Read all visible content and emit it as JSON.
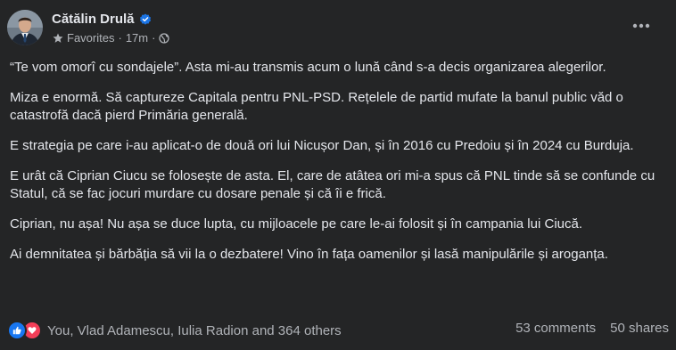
{
  "post": {
    "author": "Cătălin Drulă",
    "audience": "Favorites",
    "time": "17m",
    "paragraphs": [
      "“Te vom omorî cu sondajele”. Asta mi-au transmis acum o lună când s-a decis organizarea alegerilor.",
      "Miza e enormă. Să captureze Capitala pentru PNL-PSD. Rețelele de partid mufate la banul public văd o catastrofă dacă pierd Primăria generală.",
      "E strategia pe care i-au aplicat-o de două ori lui Nicușor Dan, și în 2016 cu Predoiu și în 2024 cu Burduja.",
      "E urât că Ciprian Ciucu se folosește de asta. El, care de atâtea ori mi-a spus că PNL tinde să se confunde cu Statul, că se fac jocuri murdare cu dosare penale și că îi e frică.",
      "Ciprian, nu așa! Nu așa se duce lupta, cu mijloacele pe care le-ai folosit și în campania lui Ciucă.",
      "Ai demnitatea și bărbăția să vii la o dezbatere! Vino în fața oamenilor și lasă manipulările și aroganța."
    ],
    "reactions_text": "You, Vlad Adamescu, Iulia Radion and 364 others",
    "comments": "53 comments",
    "shares": "50 shares"
  },
  "icons": {
    "verified": "verified-badge-icon",
    "audience": "star-icon",
    "privacy": "globe-icon",
    "more": "more-options-icon",
    "like": "like-reaction-icon",
    "love": "love-reaction-icon"
  },
  "colors": {
    "background": "#242526",
    "text_primary": "#e4e6eb",
    "text_secondary": "#b0b3b8",
    "verified_blue": "#1b74e4",
    "like_blue": "#1877f2",
    "love_red": "#f33e58"
  }
}
